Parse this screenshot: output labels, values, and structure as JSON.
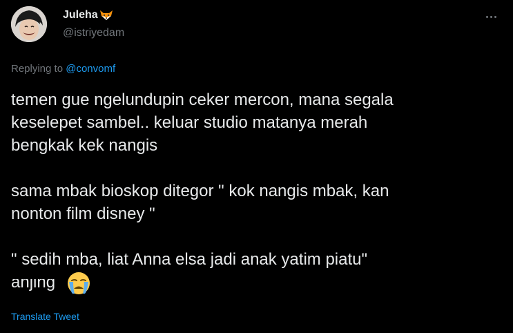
{
  "author": {
    "display_name": "Juleha",
    "handle": "@istriyedam",
    "avatar_icon": "avatar",
    "badge_icon": "fox-face-icon"
  },
  "reply": {
    "prefix": "Replying to ",
    "target": "@convomf"
  },
  "tweet": {
    "paragraph1": "temen gue ngelundupin ceker mercon,  mana segala\nkeselepet sambel..  keluar studio matanya merah\nbengkak kek nangis",
    "paragraph2": "sama mbak bioskop ditegor \" kok nangis mbak,  kan\nnonton film disney \"",
    "paragraph3": "\" sedih mba, liat Anna elsa jadi anak yatim piatu\"",
    "last_word": "anjing",
    "emoji_icon": "loudly-crying-face-icon"
  },
  "translate_label": "Translate Tweet",
  "colors": {
    "background": "#000000",
    "text": "#e7e9ea",
    "secondary": "#71767b",
    "link": "#1d9bf0"
  }
}
